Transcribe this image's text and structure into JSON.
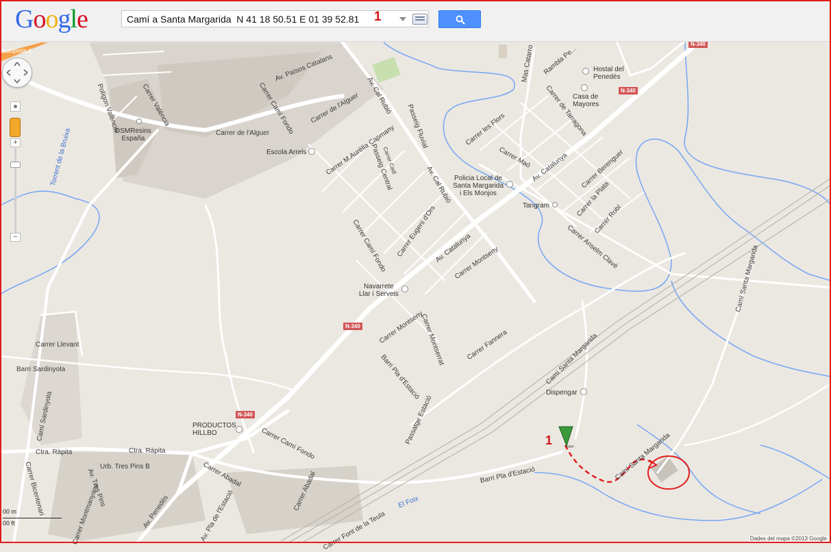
{
  "header": {
    "logo_letters": [
      {
        "char": "G",
        "color": "#3369e8"
      },
      {
        "char": "o",
        "color": "#d50f25"
      },
      {
        "char": "o",
        "color": "#eeb211"
      },
      {
        "char": "g",
        "color": "#3369e8"
      },
      {
        "char": "l",
        "color": "#009925"
      },
      {
        "char": "e",
        "color": "#d50f25"
      }
    ],
    "search_value": "Camí a Santa Margarida  N 41 18 50.51 E 01 39 52.81",
    "search_annotation": "1",
    "search_button_icon": "search-icon"
  },
  "map": {
    "roads": {
      "n340_a": "N-340",
      "n340_b": "N-340",
      "n340_c": "N-340",
      "n340_d": "N-340",
      "autopista": "Autopista d..."
    },
    "street_labels": {
      "av_paisos": "Av. Països Catalans",
      "poligon_valencia": "Polígon València",
      "carrer_valencia": "Carrer València",
      "carrer_cami_fondo_top": "Carrer Camí Fondo",
      "carrer_alguer_a": "Carrer de l'Alguer",
      "carrer_alguer_b": "Carrer de l'Alguer",
      "av_cal_rubio_a": "Av. Cal Rubió",
      "av_cal_rubio_b": "Av. Cal Rubió",
      "passeig_fluvial": "Passeig Fluvial",
      "carrer_flors": "Carrer les Flors",
      "mas_catarro": "Mas Catarro",
      "rambla": "Rambla Pe...",
      "carrer_tarragona": "Carrer de Tarragona",
      "carrer_mao": "Carrer Maó",
      "av_catalunya_a": "Av. Catalunya",
      "av_catalunya_b": "Av. Catalunya",
      "carrer_berenguer": "Carrer Berenguer",
      "carrer_plata": "Carrer la Plata",
      "carrer_robi": "Carrer Robí",
      "carrer_anselm": "Carrer Anselm Clavé",
      "carrer_aurelia": "Carrer M.Aurèlia Capmany",
      "carrer_cadi": "Carrer Cadí",
      "passeig_central": "Passeig Central",
      "carrer_cami_fondo_mid": "Carrer Camí Fondo",
      "carrer_eugeni": "Carrer Eugeni d'Ors",
      "carrer_montseny_a": "Carrer Montseny",
      "carrer_montseny_b": "Carrer Montseny",
      "carrer_montserrat": "Carrer Montserrat",
      "carrer_fannera": "Carrer Fannera",
      "barri_pla_estacio_a": "Barri Pla d'Estació",
      "barri_pla_estacio_b": "Barri Pla d'Estació",
      "passatge_estacio": "Passatge Estació",
      "cami_santa_margarida_a": "Camí Santa Margarida",
      "cami_santa_margarida_b": "Camí Santa Margarida",
      "cami_santa_margarida_c": "Camí Santa Margarida",
      "torrent_bruixa": "Torrent de la Bruixa",
      "carrer_llevant": "Carrer Llevant",
      "barri_sardinyola": "Barri Sardinyola",
      "cami_sardinyola": "Camí Sardinyola",
      "ctra_rapita_a": "Ctra. Ràpita",
      "ctra_rapita_b": "Ctra. Ràpita",
      "urb_tres_pins_b": "Urb. Tres Pins B",
      "av_tres_pins": "Av. Tres Pins",
      "carrer_bicentenari": "Carrer Bicentenari",
      "carrer_montmanyans": "Carrer Montmanyans",
      "av_penedes": "Av. Penedès",
      "carrer_abadal_a": "Carrer Abadal",
      "carrer_abadal_b": "Carrer Abadal",
      "av_pla_estacio": "Av. Pla de l'Estació",
      "carrer_cami_fondo_low": "Carrer Camí Fondo",
      "carrer_font_teula": "Carrer Font de la Teula",
      "el_foix": "El Foix"
    },
    "pois": {
      "hostal": "Hostal del\nPenedès",
      "casa_mayores": "Casa de\nMayores",
      "escola": "Escola Arrels",
      "dsm": "DSMResins\nEspaña",
      "policia": "Policia Local de\nSanta Margarida\ni Els Monjos",
      "tangram": "Tangram",
      "navarrete": "Navarrete\nLlar i Serveis",
      "dispengar": "Dispengar",
      "productos": "PRODUCTOS\nHILLBO"
    },
    "marker_annotation": "1",
    "scale": {
      "meters": "00 m",
      "feet": "00 ft"
    },
    "attribution": "Dades del mapa ©2013 Google"
  },
  "colors": {
    "water": "#7aa8f2",
    "road": "#ffffff",
    "builtup": "#d7d2cb",
    "annotation": "#d41515",
    "background": "#ebe8e2"
  }
}
